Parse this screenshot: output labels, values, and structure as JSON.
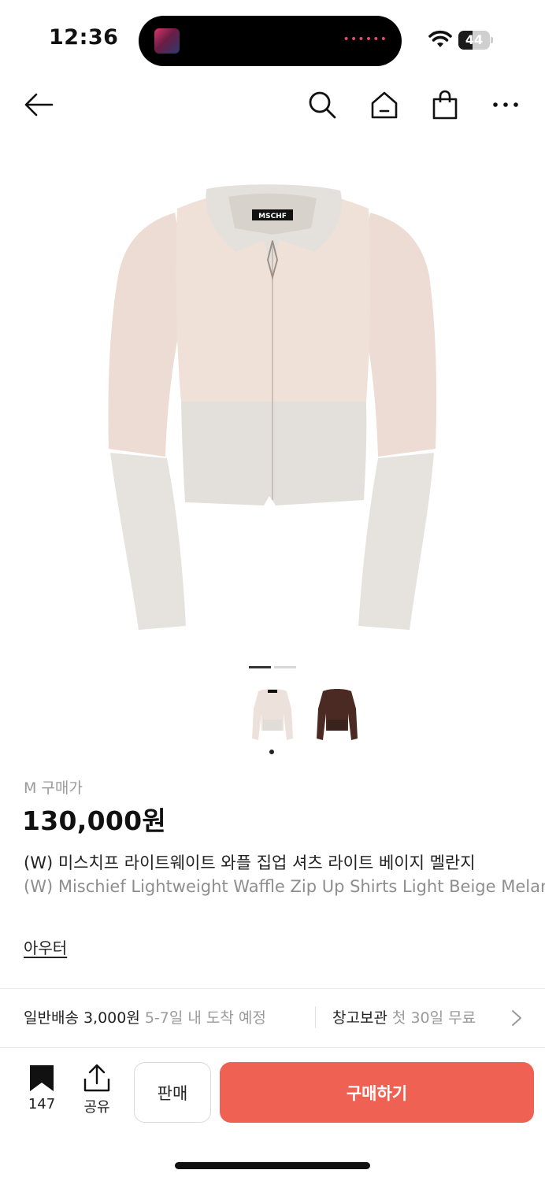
{
  "status_bar": {
    "time": "12:36",
    "battery_level": "44",
    "battery_fraction": 0.44,
    "island_dots": "••••••"
  },
  "nav": {
    "icons": [
      "back-arrow-icon",
      "search-icon",
      "home-icon",
      "shopping-bag-icon",
      "more-icon"
    ]
  },
  "gallery": {
    "page_count": 2,
    "current_page": 1,
    "thumbnails": [
      "beige-jacket-thumb",
      "brown-jacket-thumb"
    ],
    "selected_thumbnail": 1,
    "brand_tag": "MSCHF"
  },
  "product": {
    "size_label": "M 구매가",
    "price": "130,000원",
    "name_ko": "(W) 미스치프 라이트웨이트 와플 집업 셔츠 라이트 베이지 멜란지",
    "name_en": "(W) Mischief Lightweight Waffle Zip Up Shirts Light Beige Melange",
    "category": "아우터"
  },
  "shipping": {
    "standard_label": "일반배송 3,000원",
    "standard_eta": "5-7일 내 도착 예정",
    "storage_label": "창고보관",
    "storage_note": "첫 30일 무료"
  },
  "bottom_bar": {
    "bookmark_count": "147",
    "share_label": "공유",
    "sell_label": "판매",
    "buy_label": "구매하기"
  },
  "colors": {
    "buy_button": "#ef6253",
    "pager_active": "#333333",
    "pager_inactive": "#d8d8d8"
  }
}
